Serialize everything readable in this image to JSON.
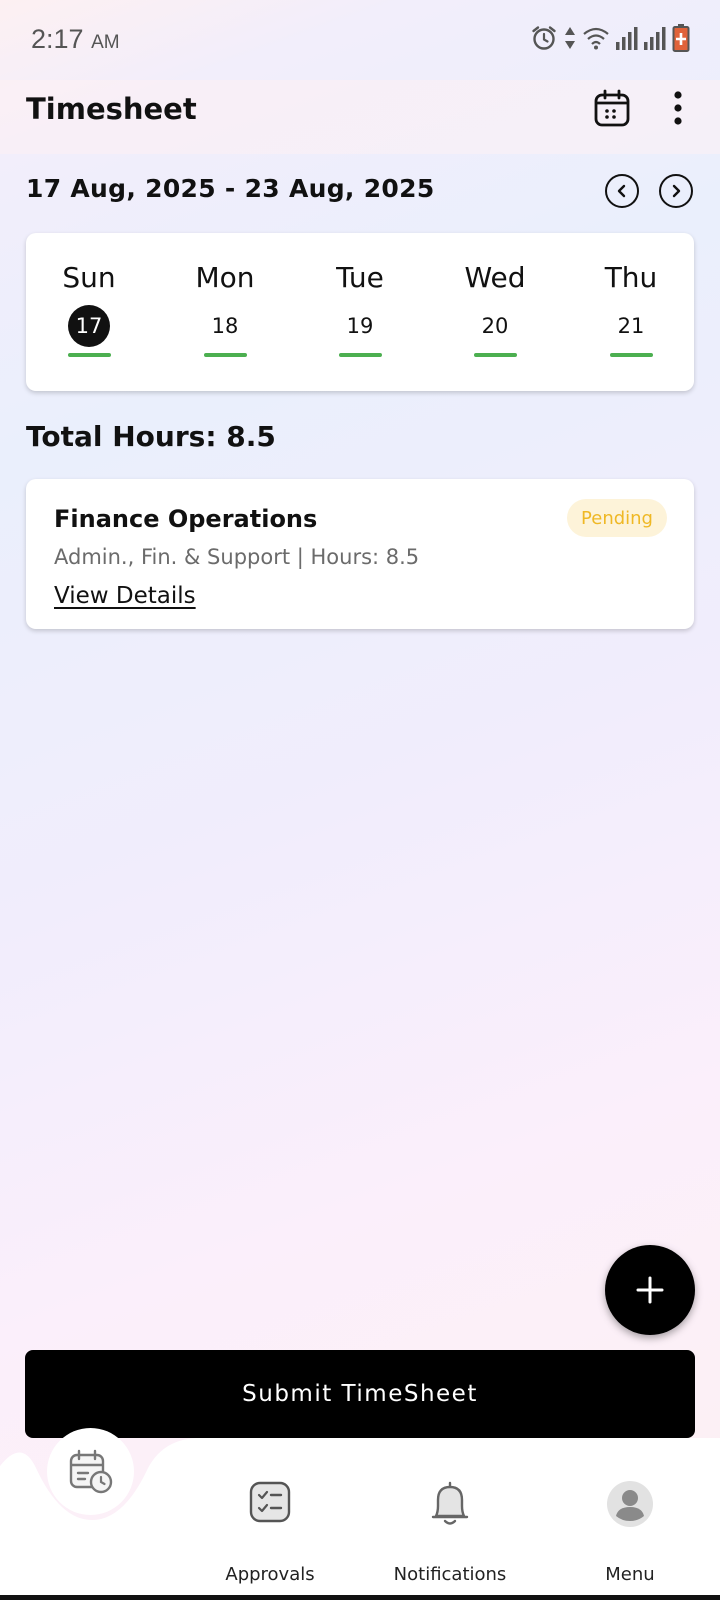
{
  "status_bar": {
    "time": "2:17",
    "ampm": "AM"
  },
  "header": {
    "title": "Timesheet"
  },
  "week": {
    "range": "17 Aug, 2025 - 23 Aug, 2025",
    "days": [
      {
        "name": "Sun",
        "num": "17",
        "selected": true
      },
      {
        "name": "Mon",
        "num": "18",
        "selected": false
      },
      {
        "name": "Tue",
        "num": "19",
        "selected": false
      },
      {
        "name": "Wed",
        "num": "20",
        "selected": false
      },
      {
        "name": "Thu",
        "num": "21",
        "selected": false
      }
    ]
  },
  "summary": {
    "total_hours": "Total Hours: 8.5"
  },
  "entry": {
    "title": "Finance Operations",
    "status": "Pending",
    "subtitle": "Admin., Fin. & Support | Hours: 8.5",
    "link": "View Details"
  },
  "actions": {
    "submit": "Submit TimeSheet"
  },
  "bottom_nav": {
    "items": [
      {
        "label": "Approvals",
        "icon": "checklist-icon"
      },
      {
        "label": "Notifications",
        "icon": "bell-icon"
      },
      {
        "label": "Menu",
        "icon": "avatar-icon"
      }
    ]
  },
  "colors": {
    "accent": "#000000",
    "day_indicator": "#4caf50",
    "pending_text": "#efb825",
    "pending_bg": "#fdf3d9"
  }
}
